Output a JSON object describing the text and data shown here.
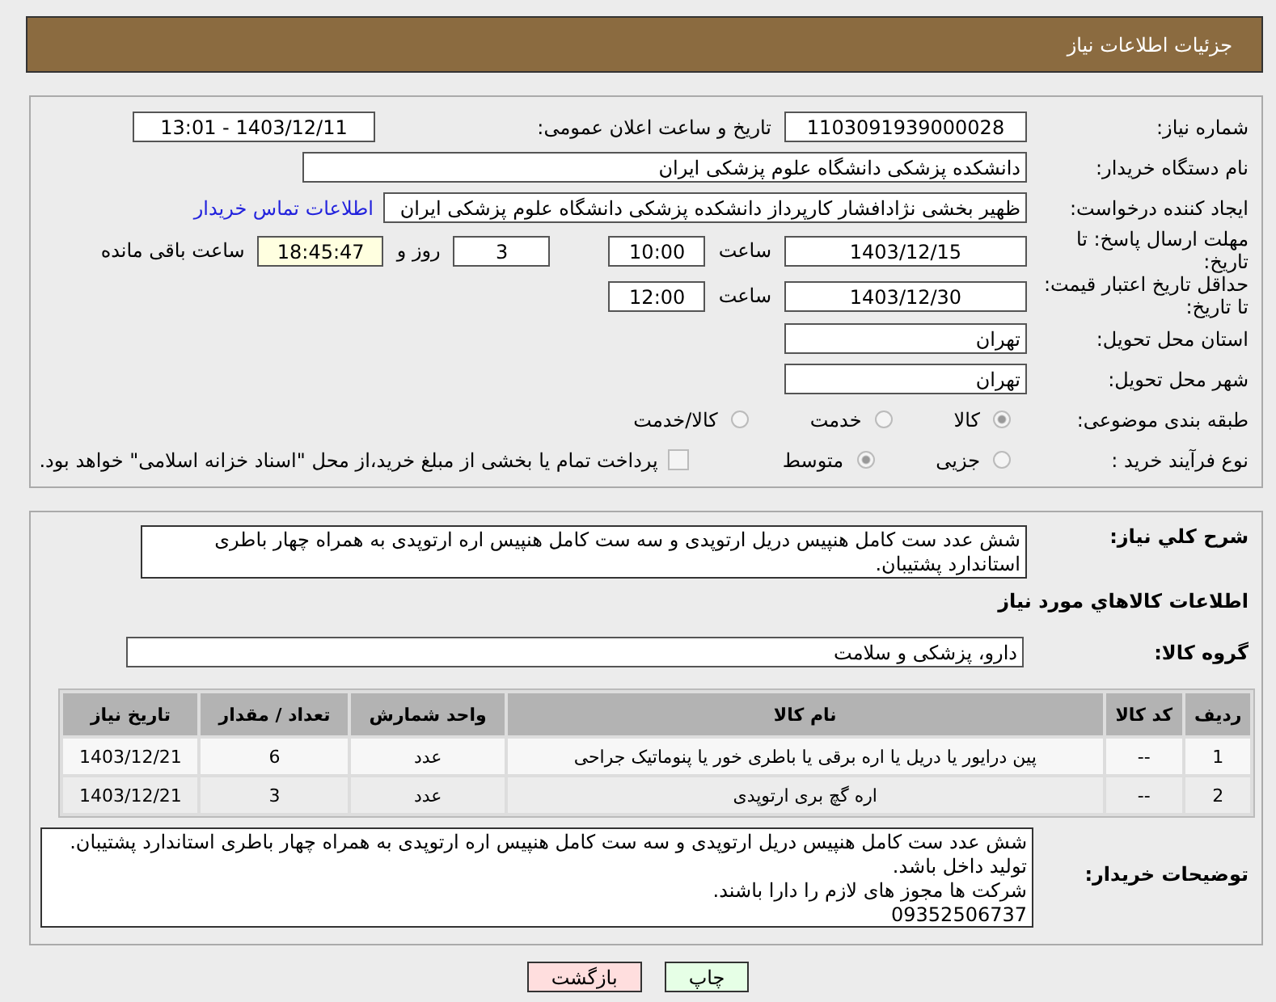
{
  "header": {
    "title": "جزئیات اطلاعات نیاز"
  },
  "need_number": {
    "label": "شماره نیاز:",
    "value": "1103091939000028"
  },
  "announce": {
    "label": "تاریخ و ساعت اعلان عمومی:",
    "value": "1403/12/11 - 13:01"
  },
  "buyer_org": {
    "label": "نام دستگاه خریدار:",
    "value": "دانشکده پزشکی دانشگاه علوم پزشکی ایران"
  },
  "requester": {
    "label": "ایجاد کننده درخواست:",
    "value": "ظهیر بخشی نژادافشار کارپرداز دانشکده پزشکی دانشگاه علوم پزشکی ایران",
    "link": "اطلاعات تماس خریدار"
  },
  "deadline": {
    "label": "مهلت ارسال پاسخ: تا تاریخ:",
    "date": "1403/12/15",
    "time_label": "ساعت",
    "time": "10:00",
    "days": "3",
    "days_label": "روز و",
    "remaining": "18:45:47",
    "remaining_label": "ساعت باقی مانده"
  },
  "validity": {
    "label": "حداقل تاریخ اعتبار قیمت: تا تاریخ:",
    "date": "1403/12/30",
    "time_label": "ساعت",
    "time": "12:00"
  },
  "province": {
    "label": "استان محل تحویل:",
    "value": "تهران"
  },
  "city": {
    "label": "شهر محل تحویل:",
    "value": "تهران"
  },
  "category": {
    "label": "طبقه بندی موضوعی:",
    "options": [
      {
        "label": "کالا",
        "selected": true
      },
      {
        "label": "خدمت",
        "selected": false
      },
      {
        "label": "کالا/خدمت",
        "selected": false
      }
    ]
  },
  "process": {
    "label": "نوع فرآیند خرید :",
    "options": [
      {
        "label": "جزیی",
        "selected": false
      },
      {
        "label": "متوسط",
        "selected": true
      }
    ],
    "checkbox": {
      "label": "پرداخت تمام یا بخشی از مبلغ خرید،از محل \"اسناد خزانه اسلامی\" خواهد بود.",
      "checked": false
    }
  },
  "description": {
    "label": "شرح کلي نياز:",
    "value": "شش عدد ست کامل هنپیس دریل ارتوپدی و سه ست کامل هنپیس اره ارتوپدی به همراه چهار باطری استاندارد پشتیبان."
  },
  "goods_title": "اطلاعات کالاهاي مورد نياز",
  "goods_group": {
    "label": "گروه کالا:",
    "value": "دارو، پزشکی و سلامت"
  },
  "table": {
    "columns": [
      "ردیف",
      "کد کالا",
      "نام کالا",
      "واحد شمارش",
      "تعداد / مقدار",
      "تاریخ نیاز"
    ],
    "rows": [
      [
        "1",
        "--",
        "پین درایور یا دریل یا اره برقی یا باطری خور یا پنوماتیک جراحی",
        "عدد",
        "6",
        "1403/12/21"
      ],
      [
        "2",
        "--",
        "اره گچ بری ارتوپدی",
        "عدد",
        "3",
        "1403/12/21"
      ]
    ]
  },
  "buyer_notes": {
    "label": "توضیحات خریدار:",
    "value": "شش عدد ست کامل هنپیس دریل ارتوپدی و سه ست کامل هنپیس اره ارتوپدی به همراه چهار باطری استاندارد پشتیبان.\nتولید داخل باشد.\nشرکت ها مجوز های لازم را دارا باشند.\n09352506737"
  },
  "buttons": [
    {
      "label": "چاپ",
      "kind": "print"
    },
    {
      "label": "بازگشت",
      "kind": "back"
    }
  ]
}
